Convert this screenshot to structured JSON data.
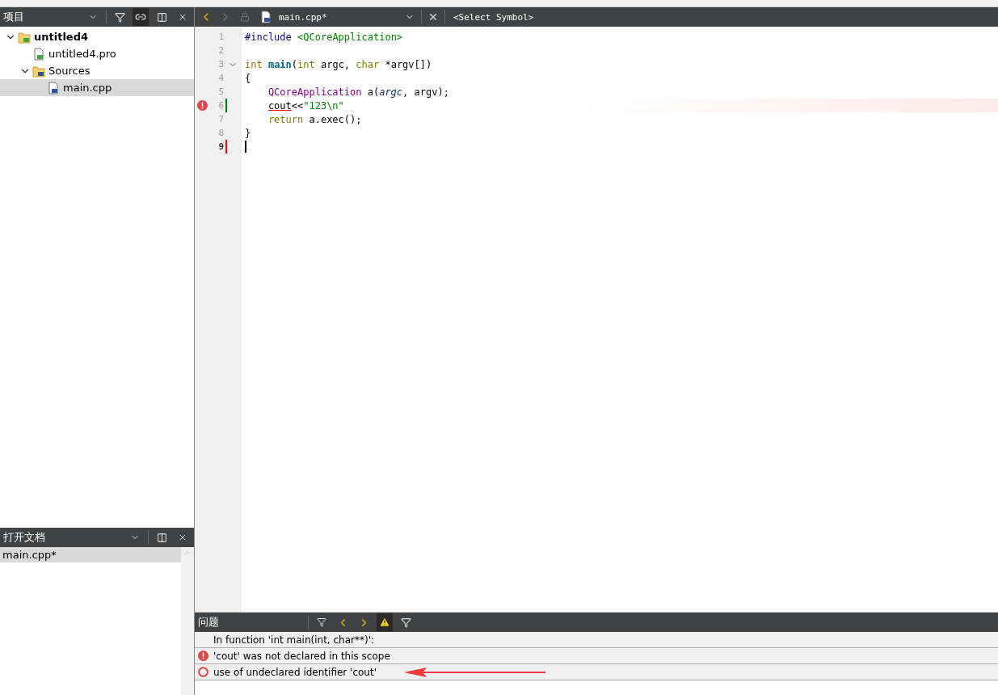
{
  "project_panel": {
    "title": "项目",
    "tree": [
      {
        "label": "untitled4",
        "kind": "project",
        "expanded": true,
        "selected": false,
        "children": [
          {
            "label": "untitled4.pro",
            "kind": "pro",
            "selected": false
          },
          {
            "label": "Sources",
            "kind": "folder",
            "expanded": true,
            "selected": false,
            "children": [
              {
                "label": "main.cpp",
                "kind": "cpp",
                "selected": true
              }
            ]
          }
        ]
      }
    ]
  },
  "open_documents": {
    "title": "打开文档",
    "items": [
      {
        "label": "main.cpp*",
        "selected": true
      }
    ]
  },
  "editor": {
    "file_name": "main.cpp*",
    "symbol": "<Select Symbol>",
    "lines": [
      {
        "number": "1",
        "error": false,
        "current": false,
        "foldable": false,
        "indented": false,
        "tokens": [
          {
            "text": "#include ",
            "kind": "preprocessor"
          },
          {
            "text": "<QCoreApplication>",
            "kind": "string"
          }
        ]
      },
      {
        "number": "2",
        "error": false,
        "current": false,
        "foldable": false
      },
      {
        "number": "3",
        "error": false,
        "current": false,
        "foldable": true,
        "indented": false,
        "tokens": [
          {
            "text": "int",
            "kind": "keyword"
          },
          {
            "text": " main",
            "kind": "function"
          },
          {
            "text": "(",
            "kind": "plain"
          },
          {
            "text": "int",
            "kind": "keyword"
          },
          {
            "text": " argc, ",
            "kind": "plain"
          },
          {
            "text": "char",
            "kind": "keyword"
          },
          {
            "text": " *argv[])",
            "kind": "plain"
          }
        ]
      },
      {
        "number": "4",
        "error": false,
        "current": false,
        "foldable": false,
        "indented": false,
        "tokens": [
          {
            "text": "{",
            "kind": "plain"
          }
        ]
      },
      {
        "number": "5",
        "error": false,
        "current": false,
        "foldable": false,
        "indented": true,
        "tokens": [
          {
            "text": "QCoreApplication",
            "kind": "type"
          },
          {
            "text": " a(",
            "kind": "plain"
          },
          {
            "text": "argc",
            "kind": "parameter"
          },
          {
            "text": ", argv);",
            "kind": "plain"
          }
        ]
      },
      {
        "number": "6",
        "error": true,
        "current": false,
        "foldable": false,
        "indented": true,
        "color": "#008000",
        "tokens": [
          {
            "text": "cout",
            "kind": "undeclared"
          },
          {
            "text": "<<",
            "kind": "plain"
          },
          {
            "text": "\"123\\n\"",
            "kind": "string"
          }
        ]
      },
      {
        "number": "7",
        "error": false,
        "current": false,
        "foldable": false,
        "indented": true,
        "tokens": [
          {
            "text": "return",
            "kind": "keyword"
          },
          {
            "text": " a.exec();",
            "kind": "plain"
          }
        ]
      },
      {
        "number": "8",
        "error": false,
        "current": false,
        "foldable": false,
        "indented": false,
        "tokens": [
          {
            "text": "}",
            "kind": "plain"
          }
        ]
      },
      {
        "number": "9",
        "error": false,
        "current": true,
        "foldable": false,
        "color": "#ff0000"
      }
    ]
  },
  "issues_panel": {
    "title": "问题",
    "warnings_filter_on": true,
    "issues": [
      {
        "kind": "context",
        "text": "In function 'int main(int, char**)':"
      },
      {
        "kind": "error",
        "text": "'cout' was not declared in this scope"
      },
      {
        "kind": "hint",
        "text": "use of undeclared identifier 'cout'"
      }
    ]
  }
}
